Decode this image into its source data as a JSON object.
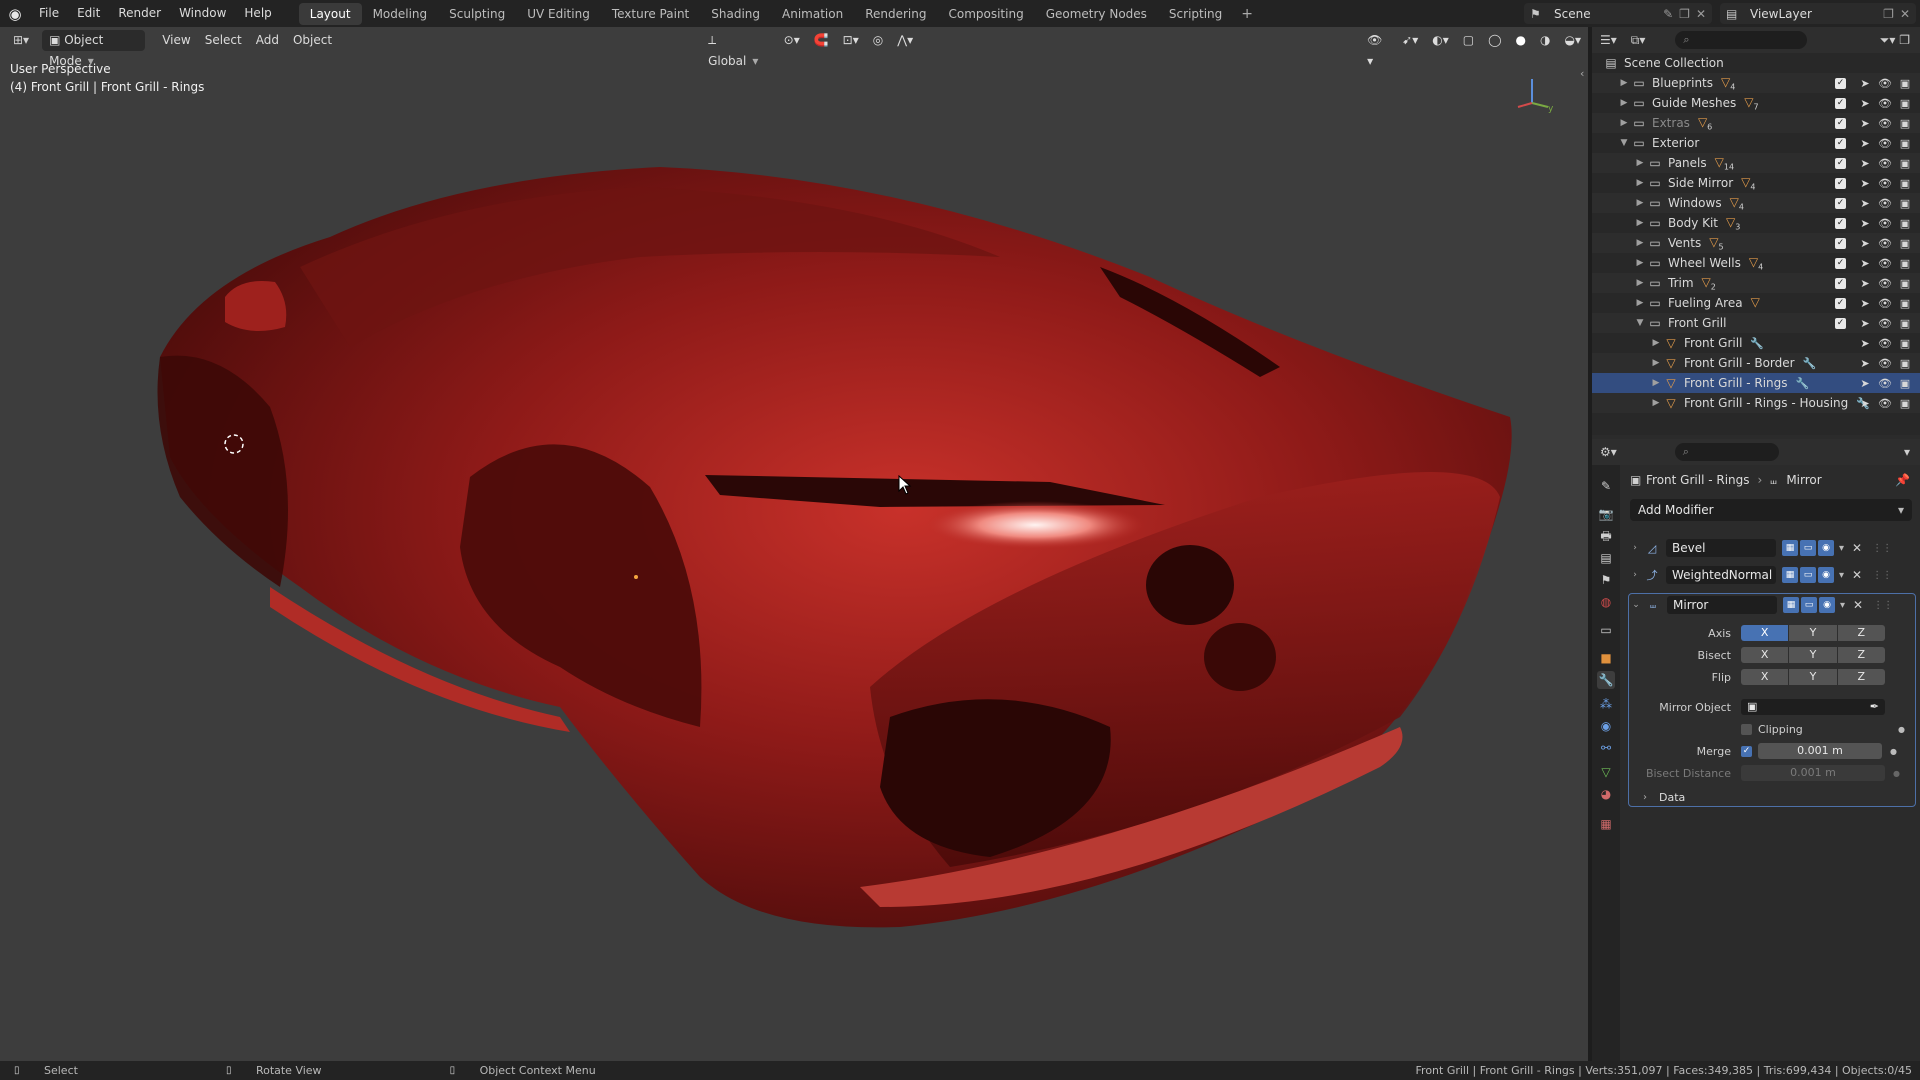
{
  "menu": [
    "File",
    "Edit",
    "Render",
    "Window",
    "Help"
  ],
  "workspaces": [
    {
      "label": "Layout",
      "active": true
    },
    {
      "label": "Modeling"
    },
    {
      "label": "Sculpting"
    },
    {
      "label": "UV Editing"
    },
    {
      "label": "Texture Paint"
    },
    {
      "label": "Shading"
    },
    {
      "label": "Animation"
    },
    {
      "label": "Rendering"
    },
    {
      "label": "Compositing"
    },
    {
      "label": "Geometry Nodes"
    },
    {
      "label": "Scripting"
    }
  ],
  "scene": {
    "name": "Scene",
    "view_layer": "ViewLayer"
  },
  "viewport": {
    "mode": "Object Mode",
    "menus": [
      "View",
      "Select",
      "Add",
      "Object"
    ],
    "orientation": "Global",
    "perspective": "User Perspective",
    "active_info": "(4) Front Grill | Front Grill - Rings"
  },
  "outliner": {
    "root": "Scene Collection",
    "rows": [
      {
        "label": "Blueprints",
        "level": 1,
        "kind": "collection",
        "count": "4",
        "expanded": false
      },
      {
        "label": "Guide Meshes",
        "level": 1,
        "kind": "collection",
        "count": "7",
        "expanded": false
      },
      {
        "label": "Extras",
        "level": 1,
        "kind": "collection",
        "count": "6",
        "expanded": false,
        "dim": true
      },
      {
        "label": "Exterior",
        "level": 1,
        "kind": "collection",
        "expanded": true
      },
      {
        "label": "Panels",
        "level": 2,
        "kind": "collection",
        "count": "14"
      },
      {
        "label": "Side Mirror",
        "level": 2,
        "kind": "collection",
        "count": "4"
      },
      {
        "label": "Windows",
        "level": 2,
        "kind": "collection",
        "count": "4"
      },
      {
        "label": "Body Kit",
        "level": 2,
        "kind": "collection",
        "count": "3"
      },
      {
        "label": "Vents",
        "level": 2,
        "kind": "collection",
        "count": "5"
      },
      {
        "label": "Wheel Wells",
        "level": 2,
        "kind": "collection",
        "count": "4"
      },
      {
        "label": "Trim",
        "level": 2,
        "kind": "collection",
        "count": "2"
      },
      {
        "label": "Fueling Area",
        "level": 2,
        "kind": "collection",
        "count": ""
      },
      {
        "label": "Front Grill",
        "level": 2,
        "kind": "collection",
        "expanded": true
      },
      {
        "label": "Front Grill",
        "level": 3,
        "kind": "object"
      },
      {
        "label": "Front Grill - Border",
        "level": 3,
        "kind": "object"
      },
      {
        "label": "Front Grill - Rings",
        "level": 3,
        "kind": "object",
        "selected": true
      },
      {
        "label": "Front Grill - Rings - Housing",
        "level": 3,
        "kind": "object"
      }
    ]
  },
  "properties": {
    "breadcrumb_object": "Front Grill - Rings",
    "breadcrumb_modifier": "Mirror",
    "add_modifier": "Add Modifier",
    "modifiers": [
      "Bevel",
      "WeightedNormal",
      "Mirror"
    ],
    "mirror": {
      "axis_label": "Axis",
      "bisect_label": "Bisect",
      "flip_label": "Flip",
      "axes": [
        "X",
        "Y",
        "Z"
      ],
      "mirror_object_label": "Mirror Object",
      "clipping_label": "Clipping",
      "merge_label": "Merge",
      "merge_value": "0.001 m",
      "bisect_distance_label": "Bisect Distance",
      "bisect_distance_value": "0.001 m",
      "data_label": "Data"
    }
  },
  "status": {
    "select": "Select",
    "rotate": "Rotate View",
    "context": "Object Context Menu",
    "stats": "Front Grill | Front Grill - Rings | Verts:351,097 | Faces:349,385 | Tris:699,434 | Objects:0/45"
  },
  "colors": {
    "accent": "#4772b3",
    "body_red": "#8e1a18",
    "selection": "#334d80",
    "object_orange": "#e09a4a"
  }
}
